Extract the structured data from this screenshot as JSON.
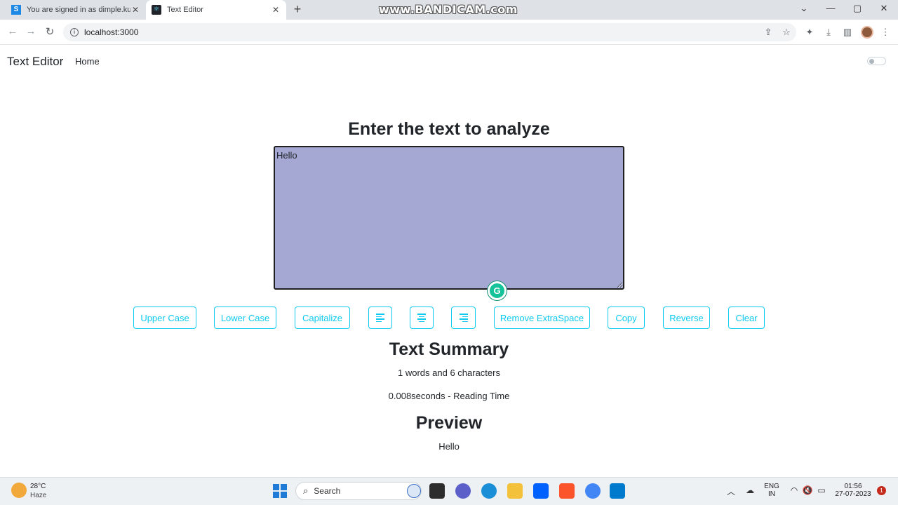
{
  "browser": {
    "tabs": [
      {
        "title": "You are signed in as dimple.kum",
        "favicon_color": "#1e88e5",
        "active": false
      },
      {
        "title": "Text Editor",
        "favicon_color": "#20232a",
        "active": true
      }
    ],
    "url": "localhost:3000",
    "recorder_watermark": "www.BANDICAM.com"
  },
  "app": {
    "brand": "Text Editor",
    "nav_home": "Home",
    "heading": "Enter the text to analyze",
    "textarea_value": "Hello ",
    "buttons": {
      "upper": "Upper Case",
      "lower": "Lower Case",
      "capitalize": "Capitalize",
      "align_left_icon": "align-left-icon",
      "align_center_icon": "align-center-icon",
      "align_right_icon": "align-right-icon",
      "remove_space": "Remove ExtraSpace",
      "copy": "Copy",
      "reverse": "Reverse",
      "clear": "Clear"
    },
    "summary_heading": "Text Summary",
    "summary_counts": "1 words and 6 characters",
    "summary_reading": "0.008seconds - Reading Time",
    "preview_heading": "Preview",
    "preview_text": "Hello",
    "accent_color": "#0dcaf0",
    "textarea_bg": "#a5a8d3"
  },
  "taskbar": {
    "weather_temp": "28°C",
    "weather_cond": "Haze",
    "search_label": "Search",
    "lang_top": "ENG",
    "lang_bottom": "IN",
    "time": "01:56",
    "date": "27-07-2023",
    "notification_count": "1"
  }
}
